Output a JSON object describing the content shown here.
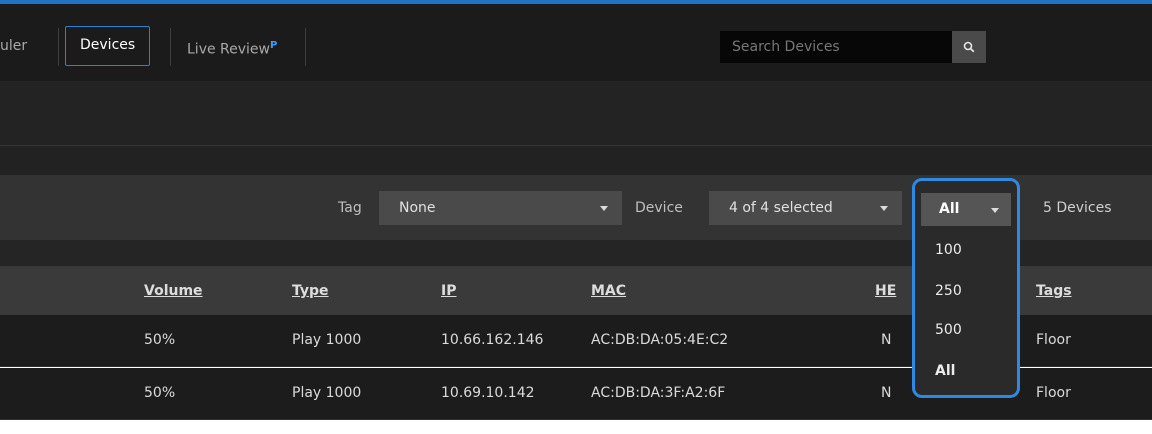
{
  "nav": {
    "items": [
      {
        "label": "uler",
        "active": false
      },
      {
        "label": "Devices",
        "active": true
      },
      {
        "label": "Live Review",
        "superscript": "P",
        "active": false
      }
    ]
  },
  "search": {
    "placeholder": "Search Devices",
    "value": "",
    "icon": "search-icon"
  },
  "filters": {
    "tag_label": "Tag",
    "tag_value": "None",
    "device_label": "Device",
    "device_value": "4 of 4 selected",
    "page_size_value": "All",
    "page_size_options": [
      "100",
      "250",
      "500",
      "All"
    ],
    "count_text": "5 Devices"
  },
  "table": {
    "columns": [
      "Volume",
      "Type",
      "IP",
      "MAC",
      "HE",
      "Tags"
    ],
    "rows": [
      {
        "volume": "50%",
        "type": "Play 1000",
        "ip": "10.66.162.146",
        "mac": "AC:DB:DA:05:4E:C2",
        "he": "N",
        "tags": "Floor"
      },
      {
        "volume": "50%",
        "type": "Play 1000",
        "ip": "10.69.10.142",
        "mac": "AC:DB:DA:3F:A2:6F",
        "he": "N",
        "tags": "Floor"
      }
    ]
  },
  "colors": {
    "accent": "#2d8ae0",
    "background": "#1c1c1c"
  }
}
